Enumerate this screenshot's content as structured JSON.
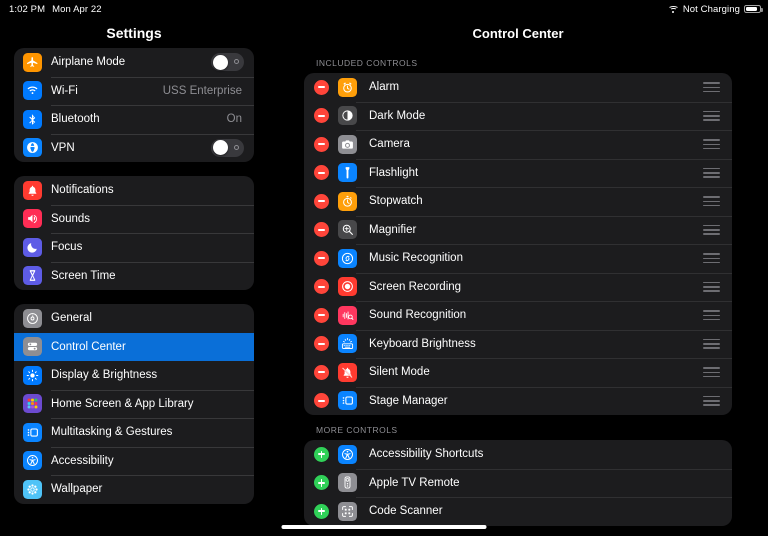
{
  "status_bar": {
    "time": "1:02 PM",
    "date": "Mon Apr 22",
    "charging_text": "Not Charging",
    "wifi_icon": "wifi-icon",
    "battery_icon": "battery-icon"
  },
  "sidebar": {
    "title": "Settings",
    "groups": [
      {
        "items": [
          {
            "label": "Airplane Mode",
            "icon": "airplane-icon",
            "color": "#ff9500",
            "control": "toggle",
            "toggle_on": false
          },
          {
            "label": "Wi-Fi",
            "icon": "wifi-icon",
            "color": "#007aff",
            "control": "value",
            "value": "USS Enterprise"
          },
          {
            "label": "Bluetooth",
            "icon": "bluetooth-icon",
            "color": "#007aff",
            "control": "value",
            "value": "On"
          },
          {
            "label": "VPN",
            "icon": "vpn-globe-icon",
            "color": "#0a84ff",
            "control": "toggle",
            "toggle_on": false
          }
        ]
      },
      {
        "items": [
          {
            "label": "Notifications",
            "icon": "bell-icon",
            "color": "#ff3b30",
            "control": "none"
          },
          {
            "label": "Sounds",
            "icon": "speaker-icon",
            "color": "#ff2d55",
            "control": "none"
          },
          {
            "label": "Focus",
            "icon": "moon-icon",
            "color": "#5e5ce6",
            "control": "none"
          },
          {
            "label": "Screen Time",
            "icon": "hourglass-icon",
            "color": "#5e5ce6",
            "control": "none"
          }
        ]
      },
      {
        "items": [
          {
            "label": "General",
            "icon": "gear-icon",
            "color": "#8e8e93",
            "control": "none",
            "selected": false
          },
          {
            "label": "Control Center",
            "icon": "control-center-icon",
            "color": "#8e8e93",
            "control": "none",
            "selected": true
          },
          {
            "label": "Display & Brightness",
            "icon": "brightness-icon",
            "color": "#007aff",
            "control": "none",
            "selected": false
          },
          {
            "label": "Home Screen & App Library",
            "icon": "app-grid-icon",
            "color": "#6c4ad0",
            "control": "none",
            "selected": false
          },
          {
            "label": "Multitasking & Gestures",
            "icon": "multitasking-icon",
            "color": "#0a84ff",
            "control": "none",
            "selected": false
          },
          {
            "label": "Accessibility",
            "icon": "accessibility-icon",
            "color": "#0a84ff",
            "control": "none",
            "selected": false
          },
          {
            "label": "Wallpaper",
            "icon": "wallpaper-icon",
            "color": "#4fc3f7",
            "control": "none",
            "selected": false
          }
        ]
      }
    ]
  },
  "detail": {
    "title": "Control Center",
    "sections": [
      {
        "header": "INCLUDED CONTROLS",
        "action": "minus",
        "items": [
          {
            "label": "Alarm",
            "icon": "alarm-clock-icon",
            "color": "#ff9f0a"
          },
          {
            "label": "Dark Mode",
            "icon": "dark-mode-icon",
            "color": "#48484a"
          },
          {
            "label": "Camera",
            "icon": "camera-icon",
            "color": "#8e8e93"
          },
          {
            "label": "Flashlight",
            "icon": "flashlight-icon",
            "color": "#0a84ff"
          },
          {
            "label": "Stopwatch",
            "icon": "stopwatch-icon",
            "color": "#ff9f0a"
          },
          {
            "label": "Magnifier",
            "icon": "magnifier-icon",
            "color": "#48484a"
          },
          {
            "label": "Music Recognition",
            "icon": "shazam-icon",
            "color": "#0a84ff"
          },
          {
            "label": "Screen Recording",
            "icon": "record-icon",
            "color": "#ff3b30"
          },
          {
            "label": "Sound Recognition",
            "icon": "sound-recognition-icon",
            "color": "#ff375f"
          },
          {
            "label": "Keyboard Brightness",
            "icon": "keyboard-brightness-icon",
            "color": "#0a84ff"
          },
          {
            "label": "Silent Mode",
            "icon": "bell-slash-icon",
            "color": "#ff3b30"
          },
          {
            "label": "Stage Manager",
            "icon": "stage-manager-icon",
            "color": "#0a84ff"
          }
        ]
      },
      {
        "header": "MORE CONTROLS",
        "action": "plus",
        "items": [
          {
            "label": "Accessibility Shortcuts",
            "icon": "accessibility-icon",
            "color": "#0a84ff"
          },
          {
            "label": "Apple TV Remote",
            "icon": "tv-remote-icon",
            "color": "#8e8e93"
          },
          {
            "label": "Code Scanner",
            "icon": "code-scanner-icon",
            "color": "#8e8e93"
          }
        ]
      }
    ]
  },
  "home_indicator": "home-indicator"
}
